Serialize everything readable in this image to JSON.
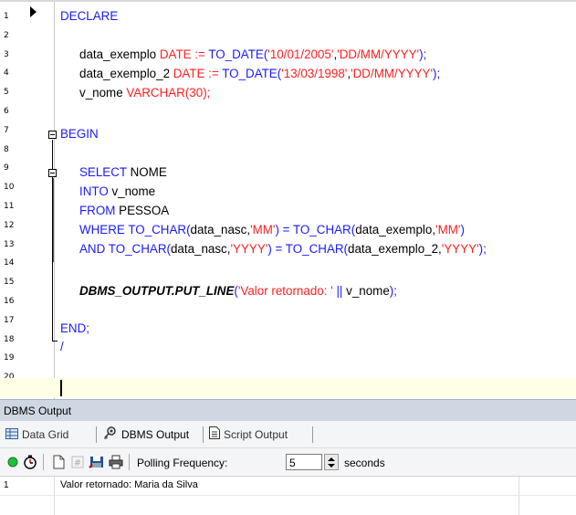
{
  "editor": {
    "line_numbers": [
      "1",
      "2",
      "3",
      "4",
      "5",
      "6",
      "7",
      "8",
      "9",
      "10",
      "11",
      "12",
      "13",
      "14",
      "15",
      "16",
      "17",
      "18",
      "19",
      "20"
    ],
    "lines": {
      "l1": {
        "kw": "DECLARE"
      },
      "l3": {
        "id1": "data_exemplo ",
        "ty": "DATE := ",
        "fn": "TO_DATE(",
        "s1": "'10/01/2005'",
        "c": ",",
        "s2": "'DD/MM/YYYY'",
        "end": ");"
      },
      "l4": {
        "id1": "data_exemplo_2 ",
        "ty": "DATE := ",
        "fn": "TO_DATE(",
        "s1": "'13/03/1998'",
        "c": ",",
        "s2": "'DD/MM/YYYY'",
        "end": ");"
      },
      "l5": {
        "id1": "v_nome ",
        "ty": "VARCHAR(30);"
      },
      "l7": {
        "kw": "BEGIN"
      },
      "l9": {
        "kw": "SELECT ",
        "id": "NOME"
      },
      "l10": {
        "kw": "INTO ",
        "id": "v_nome"
      },
      "l11": {
        "kw": "FROM ",
        "id": "PESSOA"
      },
      "l12": {
        "kw1": "WHERE TO_CHAR(",
        "id1": "data_nasc",
        "c1": ",",
        "s1": "'MM'",
        "kw2": ") = TO_CHAR(",
        "id2": "data_exemplo",
        "c2": ",",
        "s2": "'MM'",
        "kw3": ")"
      },
      "l13": {
        "kw1": "AND TO_CHAR(",
        "id1": "data_nasc",
        "c1": ",",
        "s1": "'YYYY'",
        "kw2": ") = TO_CHAR(",
        "id2": "data_exemplo_2",
        "c2": ",",
        "s2": "'YYYY'",
        "kw3": ");"
      },
      "l15": {
        "bi": "DBMS_OUTPUT.PUT_LINE",
        "p": "(",
        "s1": "'Valor retornado: '",
        "op": " || ",
        "id": "v_nome",
        "end": ");"
      },
      "l17": {
        "kw": "END;"
      },
      "l18": {
        "kw": "/"
      }
    }
  },
  "panel": {
    "title": "DBMS Output"
  },
  "tabs": [
    {
      "label": "Data Grid",
      "icon": "grid-icon"
    },
    {
      "label": "DBMS Output",
      "icon": "dbms-output-icon",
      "active": true
    },
    {
      "label": "Script Output",
      "icon": "script-output-icon"
    }
  ],
  "toolbar": {
    "polling_label": "Polling Frequency:",
    "polling_value": "5",
    "seconds_label": "seconds"
  },
  "output": {
    "rows": [
      {
        "num": "1",
        "text": "Valor retornado: Maria da Silva"
      }
    ]
  },
  "colors": {
    "keyword": "#1a1aff",
    "string": "#ff2020",
    "current_line": "#ffffe6",
    "panel_header": "#cfd7e2"
  }
}
